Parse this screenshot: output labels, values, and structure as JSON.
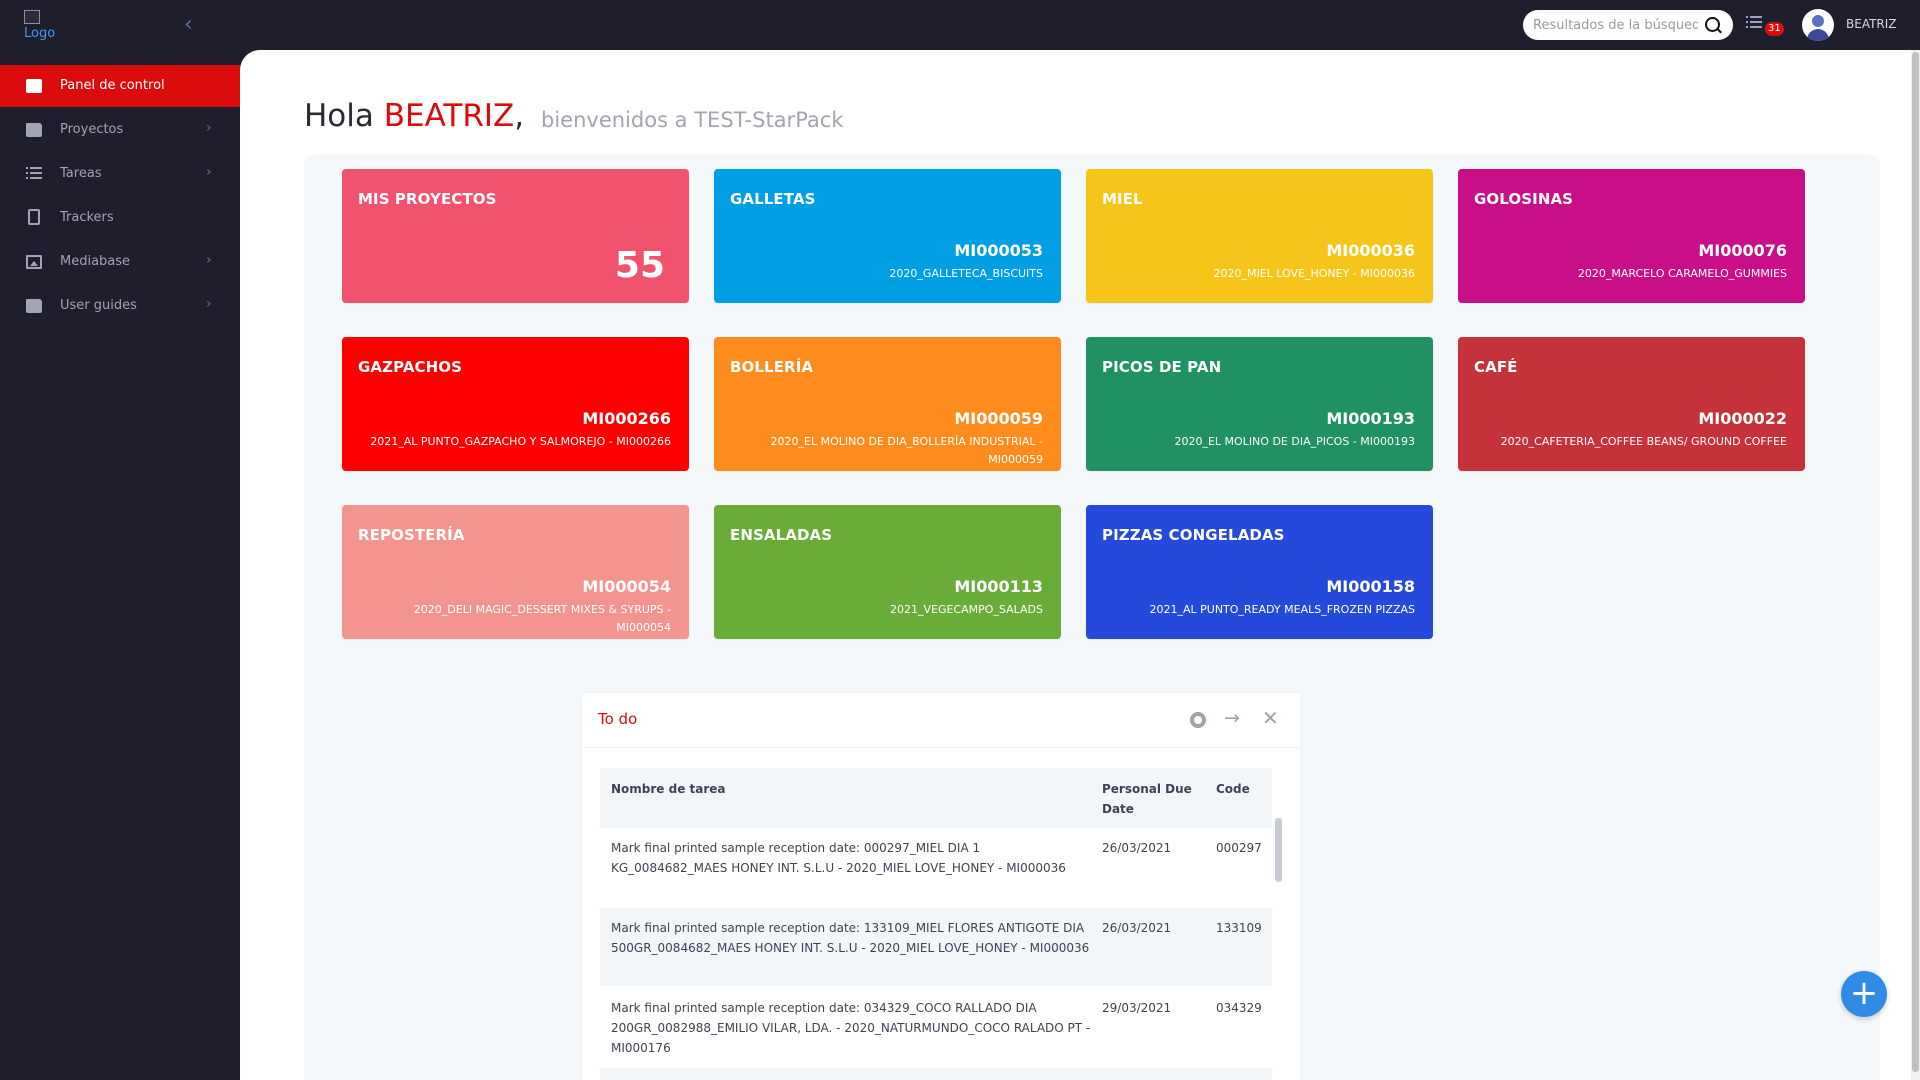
{
  "header": {
    "logo_alt": "Logo",
    "search_placeholder": "Resultados de la búsqueda",
    "tasks_badge": "31",
    "username": "BEATRIZ"
  },
  "sidebar": {
    "items": [
      {
        "label": "Panel de control",
        "icon": "cube-icon",
        "active": true
      },
      {
        "label": "Proyectos",
        "icon": "folder-open-icon"
      },
      {
        "label": "Tareas",
        "icon": "list-icon"
      },
      {
        "label": "Trackers",
        "icon": "clipboard-icon"
      },
      {
        "label": "Mediabase",
        "icon": "image-icon"
      },
      {
        "label": "User guides",
        "icon": "folder-icon"
      }
    ]
  },
  "greeting": {
    "hola": "Hola",
    "name": "BEATRIZ",
    "comma": ",",
    "welcome": "bienvenidos a TEST-StarPack"
  },
  "cards": [
    {
      "title": "MIS PROYECTOS",
      "count": "55",
      "color": "#f1536e"
    },
    {
      "title": "GALLETAS",
      "code": "MI000053",
      "subtitle": "2020_GALLETECA_BISCUITS",
      "color": "#009ee3"
    },
    {
      "title": "MIEL",
      "code": "MI000036",
      "subtitle": "2020_MIEL LOVE_HONEY - MI000036",
      "color": "#f6c51a"
    },
    {
      "title": "GOLOSINAS",
      "code": "MI000076",
      "subtitle": "2020_MARCELO CARAMELO_GUMMIES",
      "color": "#c90f88"
    },
    {
      "title": "GAZPACHOS",
      "code": "MI000266",
      "subtitle": "2021_AL PUNTO_GAZPACHO Y SALMOREJO - MI000266",
      "color": "#ff0000"
    },
    {
      "title": "BOLLERÍA",
      "code": "MI000059",
      "subtitle": "2020_EL MOLINO DE DIA_BOLLERÍA INDUSTRIAL - MI000059",
      "color": "#fd8c1c"
    },
    {
      "title": "PICOS DE PAN",
      "code": "MI000193",
      "subtitle": "2020_EL MOLINO DE DIA_PICOS - MI000193",
      "color": "#1f9163"
    },
    {
      "title": "CAFÉ",
      "code": "MI000022",
      "subtitle": "2020_CAFETERIA_COFFEE BEANS/ GROUND COFFEE",
      "color": "#c5323a"
    },
    {
      "title": "REPOSTERÍA",
      "code": "MI000054",
      "subtitle": "2020_DELI MAGIC_DESSERT MIXES & SYRUPS - MI000054",
      "color": "#f4948e"
    },
    {
      "title": "ENSALADAS",
      "code": "MI000113",
      "subtitle": "2021_VEGECAMPO_SALADS",
      "color": "#6aac38"
    },
    {
      "title": "PIZZAS CONGELADAS",
      "code": "MI000158",
      "subtitle": "2021_AL PUNTO_READY MEALS_FROZEN PIZZAS",
      "color": "#254adb"
    }
  ],
  "todo": {
    "title": "To do",
    "columns": [
      "Nombre de tarea",
      "Personal Due Date",
      "Code"
    ],
    "rows": [
      {
        "task": "Mark final printed sample reception date: 000297_MIEL DIA 1 KG_0084682_MAES HONEY INT. S.L.U - 2020_MIEL LOVE_HONEY - MI000036",
        "due": "26/03/2021",
        "code": "000297"
      },
      {
        "task": "Mark final printed sample reception date: 133109_MIEL FLORES ANTIGOTE DIA 500GR_0084682_MAES HONEY INT. S.L.U - 2020_MIEL LOVE_HONEY - MI000036",
        "due": "26/03/2021",
        "code": "133109"
      },
      {
        "task": "Mark final printed sample reception date: 034329_COCO RALLADO DIA 200GR_0082988_EMILIO VILAR, LDA. - 2020_NATURMUNDO_COCO RALADO PT - MI000176",
        "due": "29/03/2021",
        "code": "034329"
      }
    ]
  },
  "fab_label": "+"
}
